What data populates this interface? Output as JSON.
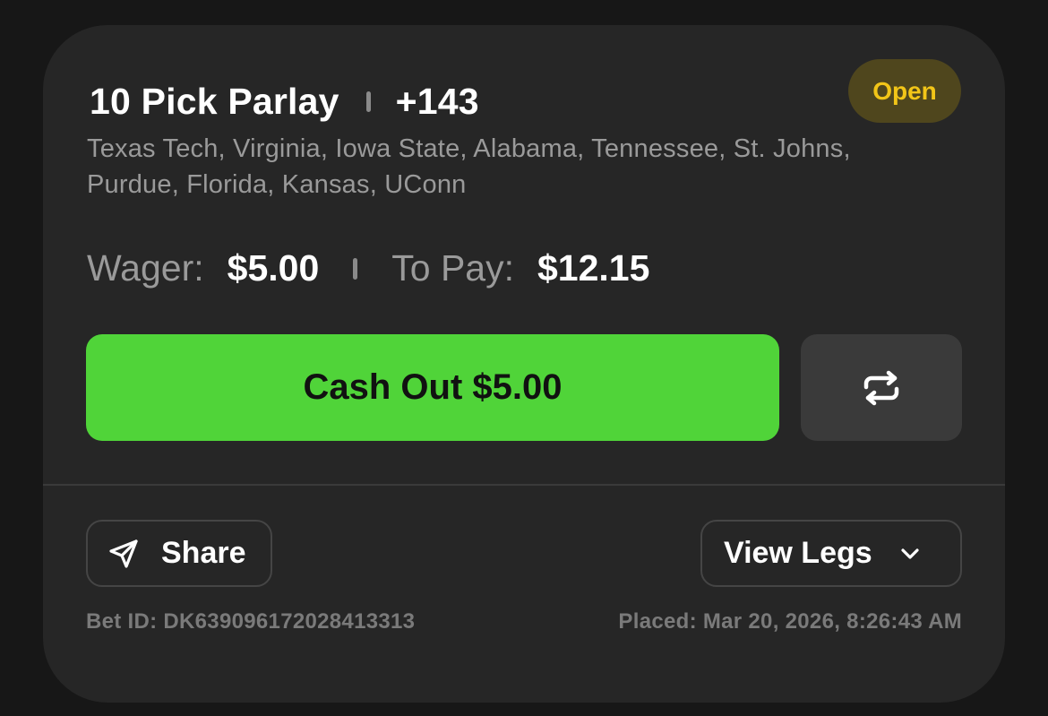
{
  "bet": {
    "title": "10 Pick Parlay",
    "odds": "+143",
    "status": "Open",
    "legs_summary": "Texas Tech, Virginia, Iowa State, Alabama, Tennessee, St. Johns, Purdue, Florida, Kansas, UConn",
    "wager_label": "Wager:",
    "wager_value": "$5.00",
    "to_pay_label": "To Pay:",
    "to_pay_value": "$12.15",
    "bet_id": "Bet ID: DK639096172028413313",
    "placed": "Placed: Mar 20, 2026, 8:26:43 AM"
  },
  "actions": {
    "cash_out_label": "Cash Out $5.00",
    "refresh_icon": "repeat-arrows-icon",
    "share_label": "Share",
    "share_icon": "paper-plane-icon",
    "view_legs_label": "View Legs",
    "view_legs_icon": "chevron-down-icon"
  },
  "colors": {
    "background": "#171717",
    "card": "#262626",
    "accent_green": "#50d439",
    "status_yellow": "#f2c518",
    "status_badge_bg": "#4f461d",
    "muted_text": "#9a9a9a"
  }
}
